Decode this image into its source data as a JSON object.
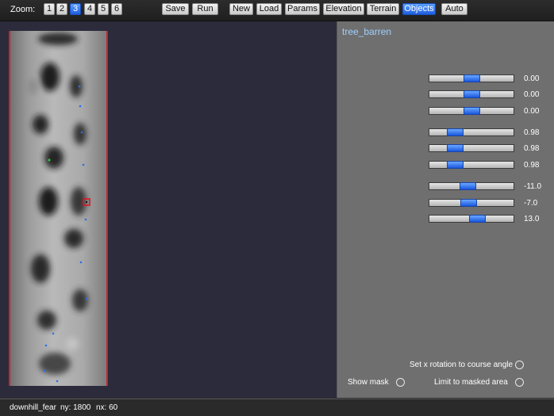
{
  "toolbar": {
    "zoom_label": "Zoom:",
    "zoom_levels": [
      "1",
      "2",
      "3",
      "4",
      "5",
      "6"
    ],
    "zoom_active": "3",
    "buttons": {
      "save": "Save",
      "run": "Run",
      "new": "New",
      "load": "Load",
      "params": "Params",
      "elevation": "Elevation",
      "terrain": "Terrain",
      "objects": "Objects",
      "auto": "Auto"
    },
    "active_mode": "Objects"
  },
  "panel": {
    "object_name": "tree_barren",
    "sliders": [
      {
        "value": "0.00",
        "level": 0.5
      },
      {
        "value": "0.00",
        "level": 0.5
      },
      {
        "value": "0.00",
        "level": 0.5
      },
      {
        "value": "0.98",
        "level": 0.31
      },
      {
        "value": "0.98",
        "level": 0.31
      },
      {
        "value": "0.98",
        "level": 0.31
      },
      {
        "value": "-11.0",
        "level": 0.46
      },
      {
        "value": "-7.0",
        "level": 0.47
      },
      {
        "value": "13.0",
        "level": 0.57
      }
    ],
    "options": {
      "x_rotation": "Set x rotation to course angle",
      "show_mask": "Show mask",
      "limit_mask": "Limit to masked area"
    }
  },
  "status": {
    "file": "downhill_fear",
    "ny": "ny: 1800",
    "nx": "nx: 60"
  },
  "colors": {
    "accent": "#2a6ef0",
    "terrain_border": "#c8242c",
    "title": "#9fd0ff"
  }
}
